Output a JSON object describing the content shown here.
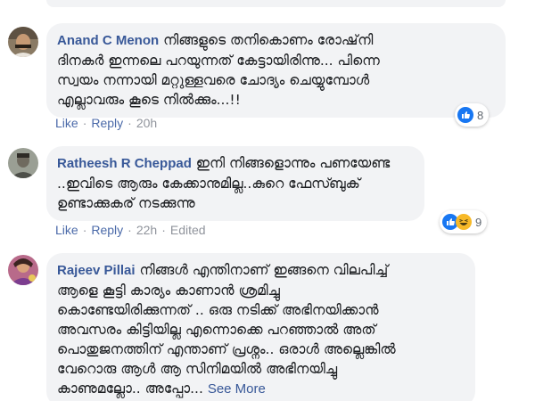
{
  "comments": [
    {
      "author": "Anand C Menon",
      "lines": [
        "നിങ്ങളുടെ തനികൊണം രോഷ്‌നി",
        "ദിനകർ ഇന്നലെ പറയുന്നത് കേട്ടായിരിന്നു... പിന്നെ",
        "സ്വയം നന്നായി മറ്റുള്ളവരെ ചോദ്യം ചെയ്യുമ്പോൾ",
        "എല്ലാവരും കൂടെ നിൽക്കും...!!"
      ],
      "like": "Like",
      "reply": "Reply",
      "time": "20h",
      "reactions": {
        "types": [
          "like-icon"
        ],
        "count": "8"
      }
    },
    {
      "author": "Ratheesh R Cheppad",
      "lines": [
        "ഇനി നിങ്ങളൊന്നും പണയേണ്ട",
        "..ഇവിടെ ആരും കേക്കാനുമില്ല..കുറെ ഫേസ്ബുക്",
        "ഉണ്ടാക്കുകര് നടക്കുന്നു"
      ],
      "like": "Like",
      "reply": "Reply",
      "time": "22h",
      "edited": "Edited",
      "reactions": {
        "types": [
          "like-icon",
          "haha-icon"
        ],
        "count": "9"
      }
    },
    {
      "author": "Rajeev Pillai",
      "lines": [
        "നിങ്ങൾ എന്തിനാണ് ഇങ്ങനെ വിലപിച്ച്",
        "ആളെ കൂട്ടി കാര്യം കാണാൻ ശ്രമിച്ചു",
        "കൊണ്ടേയിരിക്കുന്നത് .. ഒരു നടിക്ക് അഭിനയിക്കാൻ",
        "അവസരം കിട്ടിയില്ല എന്നൊക്കെ പറഞ്ഞാൽ അത്",
        "പൊതുജനത്തിന് എന്താണ് പ്രശ്നം.. ഒരാൾ അല്ലെങ്കിൽ",
        "വേറൊരു ആൾ ആ സിനിമയിൽ അഭിനയിച്ചു",
        "കാണുമല്ലോ.. അപ്പോ..."
      ],
      "see_more": "See More"
    }
  ],
  "colors": {
    "link": "#385898",
    "bubble": "#f2f3f5",
    "meta": "#90949c",
    "like_blue": "#1877f2",
    "haha_yellow": "#f7b928"
  }
}
